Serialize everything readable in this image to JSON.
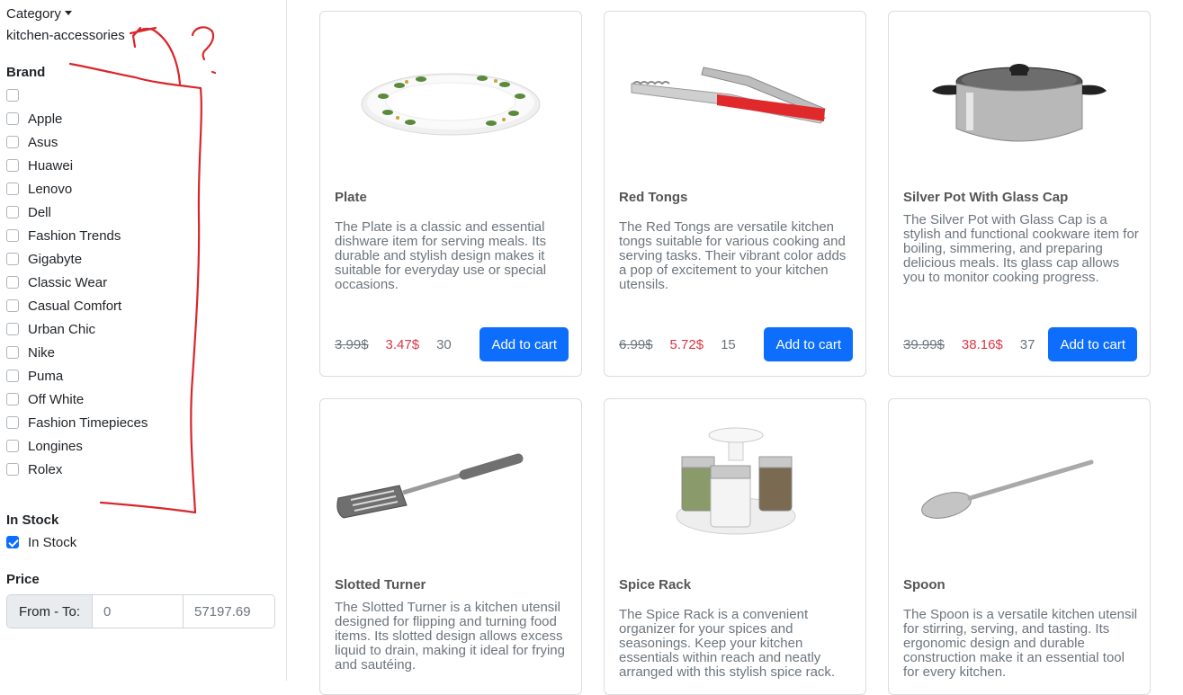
{
  "sidebar": {
    "category": {
      "toggle_label": "Category",
      "value": "kitchen-accessories"
    },
    "brand": {
      "title": "Brand",
      "items": [
        "",
        "Apple",
        "Asus",
        "Huawei",
        "Lenovo",
        "Dell",
        "Fashion Trends",
        "Gigabyte",
        "Classic Wear",
        "Casual Comfort",
        "Urban Chic",
        "Nike",
        "Puma",
        "Off White",
        "Fashion Timepieces",
        "Longines",
        "Rolex"
      ]
    },
    "in_stock": {
      "title": "In Stock",
      "label": "In Stock",
      "checked": true
    },
    "price": {
      "title": "Price",
      "label": "From - To:",
      "from": "0",
      "to": "57197.69"
    }
  },
  "colors": {
    "accent": "#0d6efd",
    "sale": "#dc3545",
    "annotation": "#d9262c"
  },
  "products": [
    {
      "name": "Plate",
      "description": "The Plate is a classic and essential dishware item for serving meals. Its durable and stylish design makes it suitable for everyday use or special occasions.",
      "old_price": "3.99$",
      "price": "3.47$",
      "stock": "30",
      "button": "Add to cart",
      "image": "plate"
    },
    {
      "name": "Red Tongs",
      "description": "The Red Tongs are versatile kitchen tongs suitable for various cooking and serving tasks. Their vibrant color adds a pop of excitement to your kitchen utensils.",
      "old_price": "6.99$",
      "price": "5.72$",
      "stock": "15",
      "button": "Add to cart",
      "image": "tongs"
    },
    {
      "name": "Silver Pot With Glass Cap",
      "description": "The Silver Pot with Glass Cap is a stylish and functional cookware item for boiling, simmering, and preparing delicious meals. Its glass cap allows you to monitor cooking progress.",
      "old_price": "39.99$",
      "price": "38.16$",
      "stock": "37",
      "button": "Add to cart",
      "image": "pot"
    },
    {
      "name": "Slotted Turner",
      "description": "The Slotted Turner is a kitchen utensil designed for flipping and turning food items. Its slotted design allows excess liquid to drain, making it ideal for frying and sautéing.",
      "image": "turner"
    },
    {
      "name": "Spice Rack",
      "description": "The Spice Rack is a convenient organizer for your spices and seasonings. Keep your kitchen essentials within reach and neatly arranged with this stylish spice rack.",
      "image": "spice-rack"
    },
    {
      "name": "Spoon",
      "description": "The Spoon is a versatile kitchen utensil for stirring, serving, and tasting. Its ergonomic design and durable construction make it an essential tool for every kitchen.",
      "image": "spoon"
    }
  ]
}
